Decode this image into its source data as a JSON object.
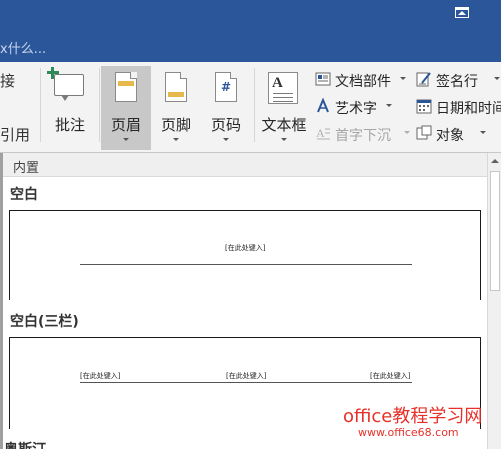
{
  "tell_me": {
    "text": "x什么..."
  },
  "ribbon": {
    "left_fragments": [
      "接",
      "引用"
    ],
    "buttons": {
      "comment": "批注",
      "header": "页眉",
      "footer": "页脚",
      "page_number": "页码",
      "textbox": "文本框"
    },
    "small": {
      "quick_parts": "文档部件",
      "wordart": "艺术字",
      "dropcap": "首字下沉",
      "signature": "签名行",
      "datetime": "日期和时间",
      "object": "对象"
    }
  },
  "gallery": {
    "section": "内置",
    "items": [
      {
        "title": "空白",
        "placeholders": [
          "[在此处键入]"
        ]
      },
      {
        "title": "空白(三栏)",
        "placeholders": [
          "[在此处键入]",
          "[在此处键入]",
          "[在此处键入]"
        ]
      },
      {
        "title": "奥斯汀"
      }
    ]
  },
  "watermark": {
    "line1": "office教程学习网",
    "line2": "www.office68.com"
  },
  "colors": {
    "titlebar": "#2b579a",
    "ribbon": "#f3f3f3",
    "active_button": "#c8c8c8",
    "watermark": "#e8302a"
  }
}
